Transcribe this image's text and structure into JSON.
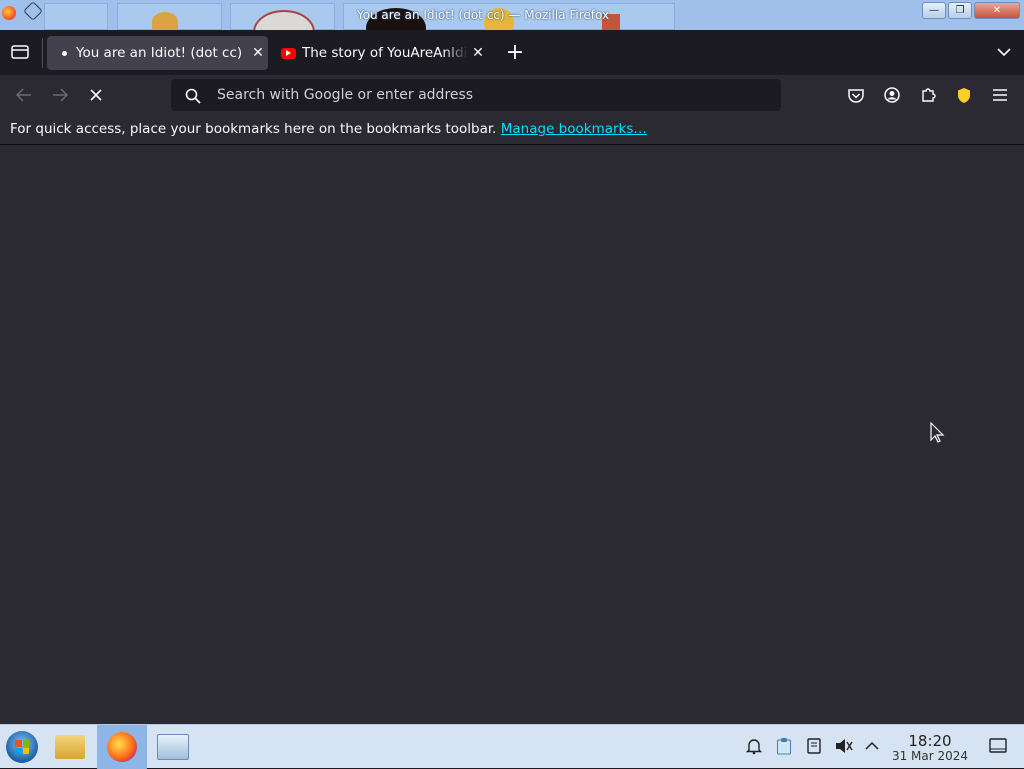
{
  "window": {
    "title": "You are an Idiot! (dot cc) — Mozilla Firefox",
    "minimize": "—",
    "maximize": "❐",
    "close": "✕"
  },
  "tabs": [
    {
      "label": "You are an Idiot! (dot cc)",
      "active": true,
      "icon": "page-dot-icon"
    },
    {
      "label": "The story of YouAreAnIdiot",
      "active": false,
      "icon": "youtube-icon"
    }
  ],
  "new_tab_label": "+",
  "urlbar": {
    "value": "",
    "placeholder": "Search with Google or enter address"
  },
  "bookmarks_bar": {
    "message": "For quick access, place your bookmarks here on the bookmarks toolbar.",
    "link": "Manage bookmarks…"
  },
  "clock": {
    "time": "18:20",
    "date": "31 Mar 2024"
  },
  "colors": {
    "tab_active": "#42414d",
    "toolbar": "#2b2a33",
    "accent_link": "#00ddff",
    "taskbar": "#d6e3f2"
  }
}
